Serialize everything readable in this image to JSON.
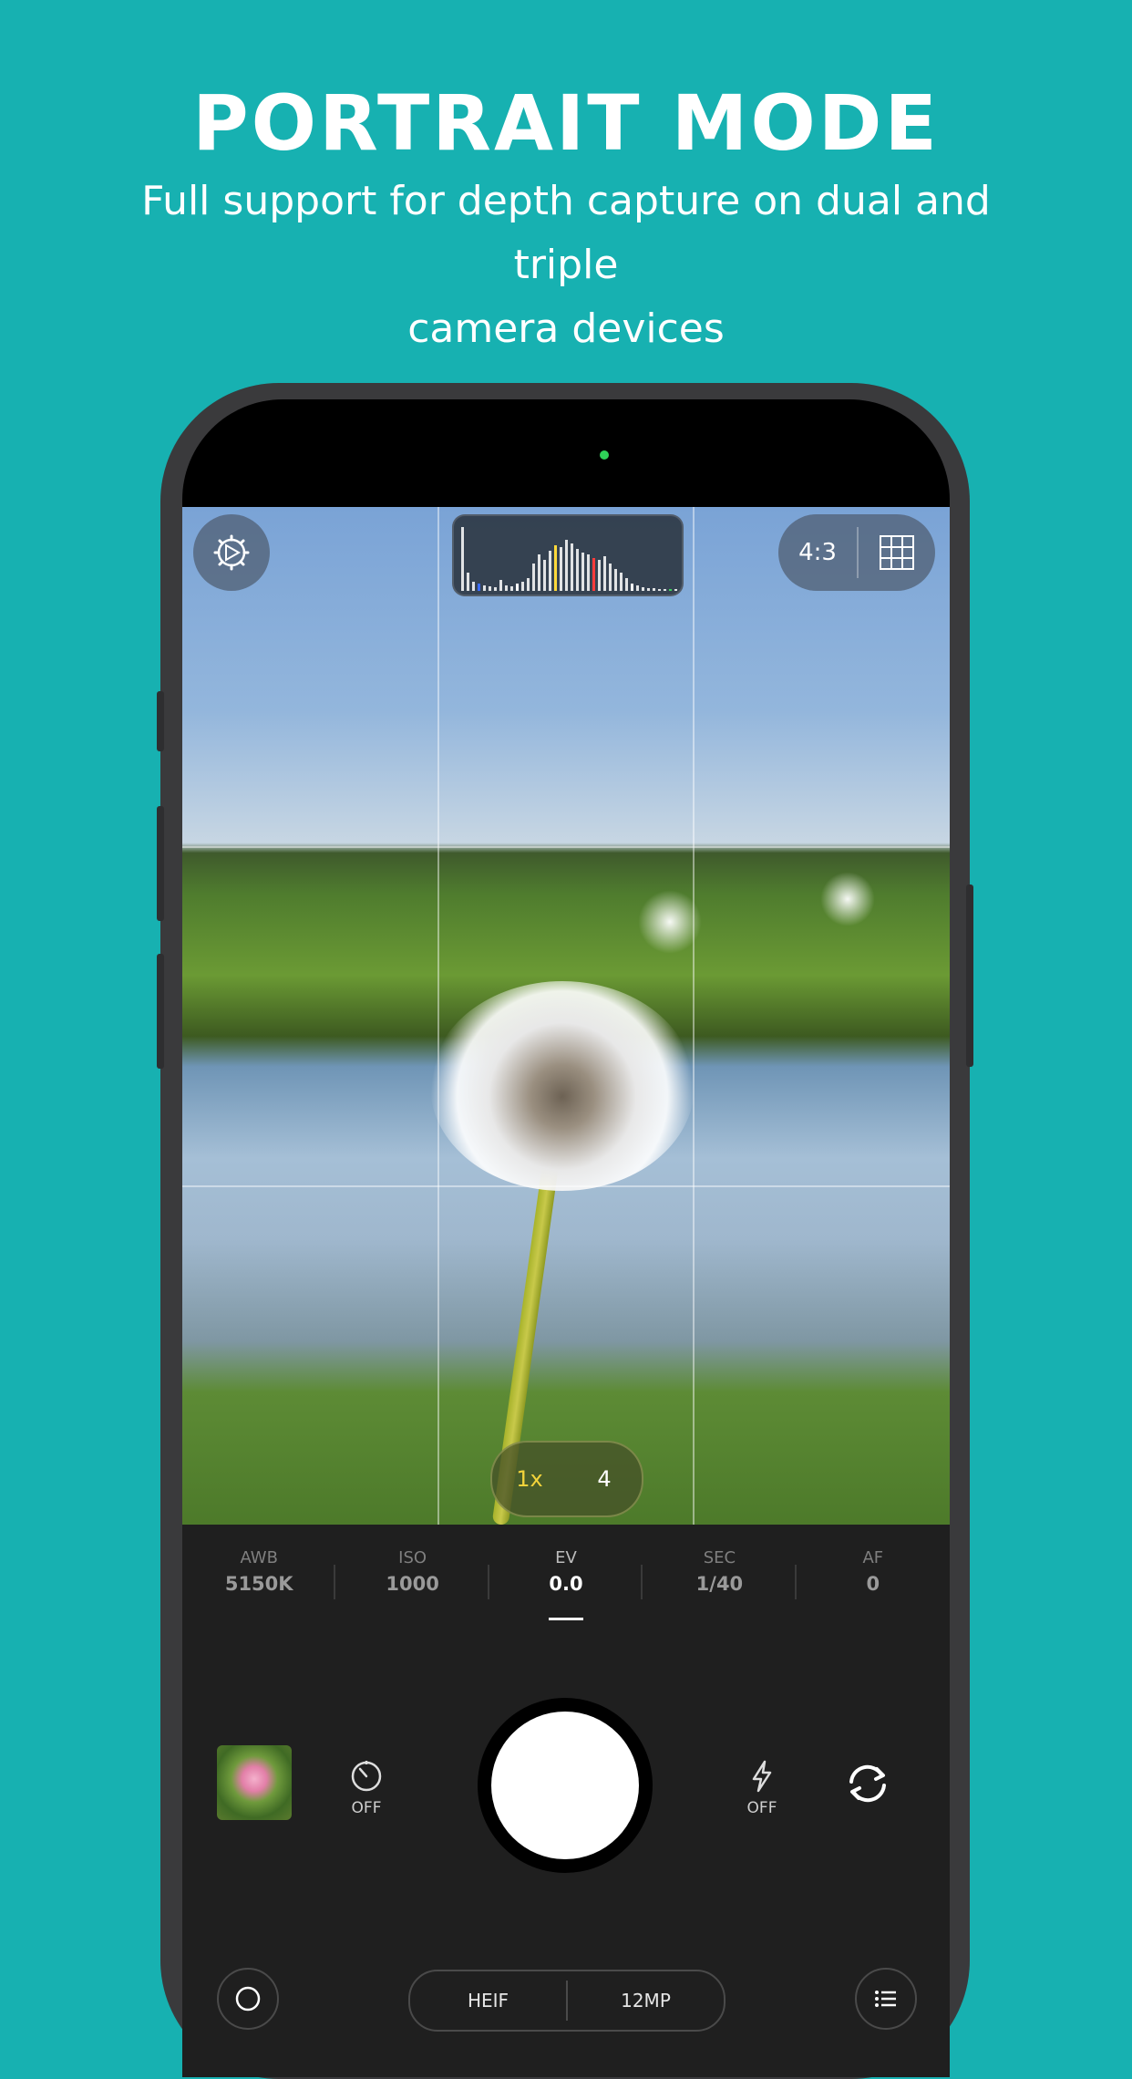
{
  "header": {
    "title": "PORTRAIT MODE",
    "subtitle_line1": "Full support for depth capture on dual and triple",
    "subtitle_line2": "camera devices"
  },
  "colors": {
    "background": "#17b1b1",
    "zoom_active": "#f2d33b",
    "camera_indicator": "#2fd158"
  },
  "viewfinder": {
    "settings_icon": "settings-gear-icon",
    "aspect_ratio": "4:3",
    "grid_icon": "grid-icon",
    "zoom": {
      "active": "1x",
      "other": "4"
    }
  },
  "params": [
    {
      "label": "AWB",
      "value": "5150K"
    },
    {
      "label": "ISO",
      "value": "1000"
    },
    {
      "label": "EV",
      "value": "0.0"
    },
    {
      "label": "SEC",
      "value": "1/40"
    },
    {
      "label": "AF",
      "value": "0"
    }
  ],
  "active_param": "EV",
  "controls": {
    "timer_state": "OFF",
    "flash_state": "OFF",
    "format": "HEIF",
    "resolution": "12MP"
  }
}
